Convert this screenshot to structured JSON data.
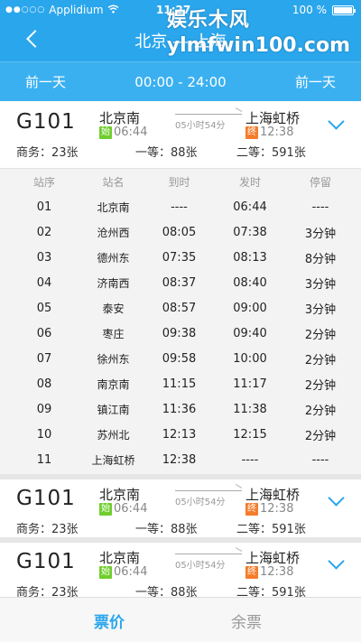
{
  "status_bar": {
    "carrier": "Applidium",
    "signal_dots": "●●○○○",
    "time": "11:27",
    "battery": "100 %"
  },
  "navbar": {
    "title": "北京 — 上海"
  },
  "watermark": {
    "line1": "娱乐木风",
    "line2": "ylmfwin100.com"
  },
  "day_bar": {
    "prev": "前一天",
    "range": "00:00 - 24:00",
    "next": "前一天"
  },
  "trains": [
    {
      "number": "G101",
      "from": "北京南",
      "to": "上海虹桥",
      "dep_tag": "始",
      "dep_time": "06:44",
      "arr_tag": "终",
      "arr_time": "12:38",
      "duration": "05小时54分",
      "seat_business": "商务：23张",
      "seat_first": "一等：88张",
      "seat_second": "二等：591张"
    },
    {
      "number": "G101",
      "from": "北京南",
      "to": "上海虹桥",
      "dep_tag": "始",
      "dep_time": "06:44",
      "arr_tag": "终",
      "arr_time": "12:38",
      "duration": "05小时54分",
      "seat_business": "商务：23张",
      "seat_first": "一等：88张",
      "seat_second": "二等：591张"
    },
    {
      "number": "G101",
      "from": "北京南",
      "to": "上海虹桥",
      "dep_tag": "始",
      "dep_time": "06:44",
      "arr_tag": "终",
      "arr_time": "12:38",
      "duration": "05小时54分",
      "seat_business": "商务：23张",
      "seat_first": "一等：88张",
      "seat_second": "二等：591张"
    }
  ],
  "stops_table": {
    "headers": [
      "站序",
      "站名",
      "到时",
      "发时",
      "停留"
    ],
    "rows": [
      [
        "01",
        "北京南",
        "----",
        "06:44",
        "----"
      ],
      [
        "02",
        "沧州西",
        "08:05",
        "07:38",
        "3分钟"
      ],
      [
        "03",
        "德州东",
        "07:35",
        "08:13",
        "8分钟"
      ],
      [
        "04",
        "济南西",
        "08:37",
        "08:40",
        "3分钟"
      ],
      [
        "05",
        "泰安",
        "08:57",
        "09:00",
        "3分钟"
      ],
      [
        "06",
        "枣庄",
        "09:38",
        "09:40",
        "2分钟"
      ],
      [
        "07",
        "徐州东",
        "09:58",
        "10:00",
        "2分钟"
      ],
      [
        "08",
        "南京南",
        "11:15",
        "11:17",
        "2分钟"
      ],
      [
        "09",
        "镇江南",
        "11:36",
        "11:38",
        "2分钟"
      ],
      [
        "10",
        "苏州北",
        "12:13",
        "12:15",
        "2分钟"
      ],
      [
        "11",
        "上海虹桥",
        "12:38",
        "----",
        "----"
      ]
    ]
  },
  "tab_bar": {
    "tab1": "票价",
    "tab2": "余票"
  },
  "colors": {
    "header_blue": "#2aa6ec",
    "start_tag_green": "#6fce2d",
    "end_tag_orange": "#f57c2a"
  }
}
